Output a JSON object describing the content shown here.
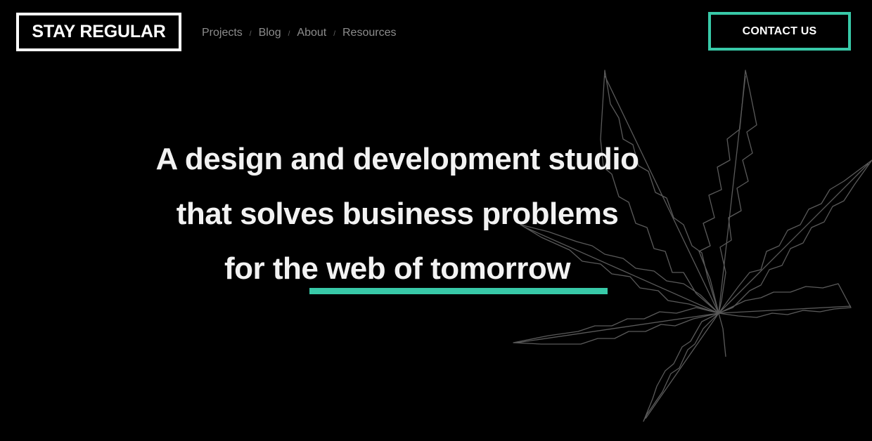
{
  "brand": {
    "logo_text": "STAY REGULAR"
  },
  "nav": {
    "items": [
      {
        "label": "Projects"
      },
      {
        "label": "Blog"
      },
      {
        "label": "About"
      },
      {
        "label": "Resources"
      }
    ],
    "separator": "/"
  },
  "header": {
    "contact_label": "CONTACT US"
  },
  "hero": {
    "line1": "A design and development studio",
    "line2": "that solves business problems",
    "line3_prefix": "for the ",
    "line3_highlight": "web of tomorrow"
  },
  "colors": {
    "background": "#000000",
    "accent": "#38c9a8",
    "text": "#f2f2f2",
    "nav_text": "#8c8c8c"
  },
  "icons": {
    "decoration": "cannabis-leaf-outline"
  }
}
